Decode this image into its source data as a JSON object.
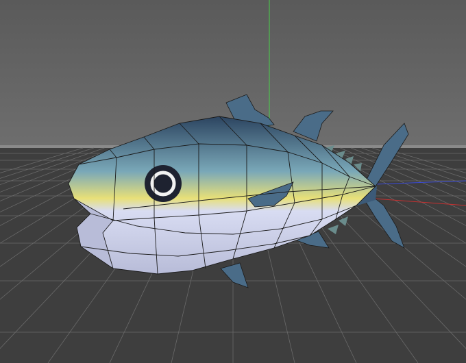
{
  "viewport": {
    "colors": {
      "sky_top": "#5a5a5a",
      "sky_bottom": "#6e6e6e",
      "horizon": "#8a8a8a",
      "floor": "#3e3e3e",
      "grid": "#6a6a6a",
      "axis_x": "#c83030",
      "axis_y": "#4ad04a",
      "axis_z": "#3a4ad8",
      "wire": "#1a1a1a"
    }
  },
  "model": {
    "kind": "low-poly tuna",
    "colors": {
      "back": "#3c5a78",
      "back_dark": "#2c4460",
      "side": "#7aa8b8",
      "stripe": "#e8e078",
      "belly": "#d8dcf2",
      "belly_shadow": "#b8bcd8",
      "eye_ring": "#f2f2f2",
      "eye_dark": "#1e2230",
      "fin": "#4a6c88",
      "finlet": "#6a8c8c"
    }
  }
}
